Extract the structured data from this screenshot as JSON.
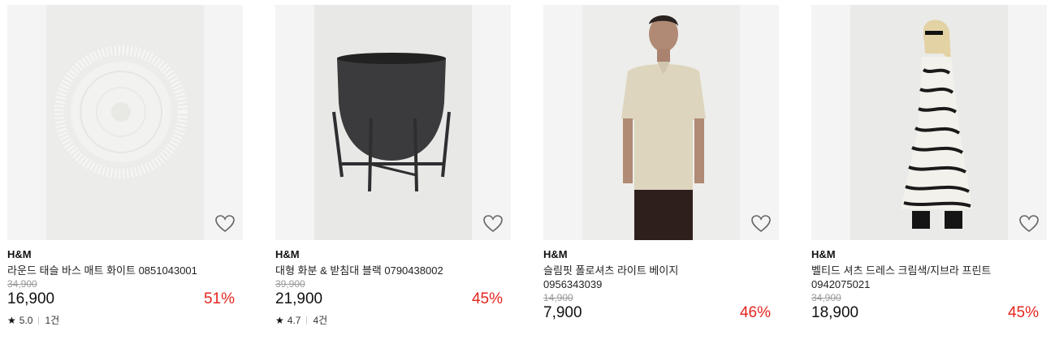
{
  "products": [
    {
      "brand": "H&M",
      "name": "라운드 태슬 바스 매트 화이트 0851043001",
      "original_price": "34,900",
      "price": "16,900",
      "discount": "51%",
      "rating": "5.0",
      "review_count": "1건",
      "image": "round-tassel-bath-mat-image"
    },
    {
      "brand": "H&M",
      "name": "대형 화분 & 받침대 블랙 0790438002",
      "original_price": "39,900",
      "price": "21,900",
      "discount": "45%",
      "rating": "4.7",
      "review_count": "4건",
      "image": "planter-with-stand-image"
    },
    {
      "brand": "H&M",
      "name": "슬림핏 폴로셔츠 라이트 베이지 0956343039",
      "original_price": "14,900",
      "price": "7,900",
      "discount": "46%",
      "image": "polo-shirt-model-image"
    },
    {
      "brand": "H&M",
      "name": "벨티드 셔츠 드레스 크림색/지브라 프린트 0942075021",
      "original_price": "34,900",
      "price": "18,900",
      "discount": "45%",
      "image": "zebra-shirt-dress-model-image"
    }
  ],
  "icons": {
    "wishlist": "heart-outline-icon",
    "rating": "star-icon"
  },
  "colors": {
    "discount": "#e4251f",
    "thumb_bg": "#f4f4f4",
    "original_price": "#9a9a9a"
  }
}
